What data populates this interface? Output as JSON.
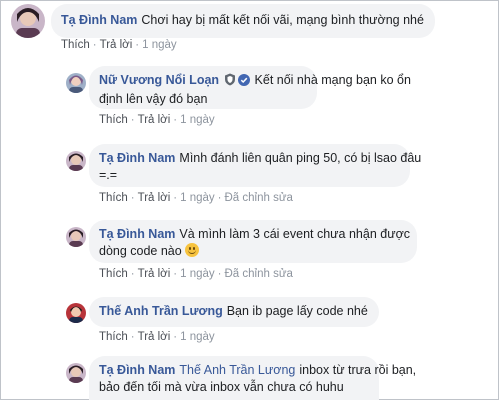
{
  "comments": [
    {
      "author": "Tạ Đình Nam",
      "text": "Chơi hay bị mất kết nối vãi, mạng bình thường nhé",
      "actions": {
        "like": "Thích",
        "reply": "Trả lời",
        "time": "1 ngày"
      }
    },
    {
      "author": "Nữ Vương Nổi Loạn",
      "badge_icon": "moderator-shield-icon",
      "verified_icon": "verified-check-icon",
      "text_line1": "Kết nối nhà mạng bạn ko ổn",
      "text_line2": "định lên vậy đó bạn",
      "actions": {
        "like": "Thích",
        "reply": "Trả lời",
        "time": "1 ngày"
      }
    },
    {
      "author": "Tạ Đình Nam",
      "text_line1": "Mình đánh liên quân ping 50, có bị lsao đâu",
      "text_line2": "=.=",
      "actions": {
        "like": "Thích",
        "reply": "Trả lời",
        "time": "1 ngày",
        "edited": "Đã chỉnh sửa"
      }
    },
    {
      "author": "Tạ Đình Nam",
      "text_line1": "Và mình làm 3 cái event chưa nhận được",
      "text_line2": "dòng code nào",
      "emoji": "smile-emoji-icon",
      "actions": {
        "like": "Thích",
        "reply": "Trả lời",
        "time": "1 ngày",
        "edited": "Đã chỉnh sửa"
      }
    },
    {
      "author": "Thế Anh Trần Lương",
      "text": "Bạn ib page lấy code nhé",
      "actions": {
        "like": "Thích",
        "reply": "Trả lời",
        "time": "1 ngày"
      }
    },
    {
      "author": "Tạ Đình Nam",
      "mention": "Thế Anh Trần Lương",
      "text_line1": "inbox từ trưa rồi bạn,",
      "text_line2": "bảo đến tối mà vừa inbox vẫn chưa có huhu"
    }
  ],
  "colors": {
    "name": "#385898",
    "bubble": "#f2f3f5",
    "meta": "#8d949e"
  }
}
